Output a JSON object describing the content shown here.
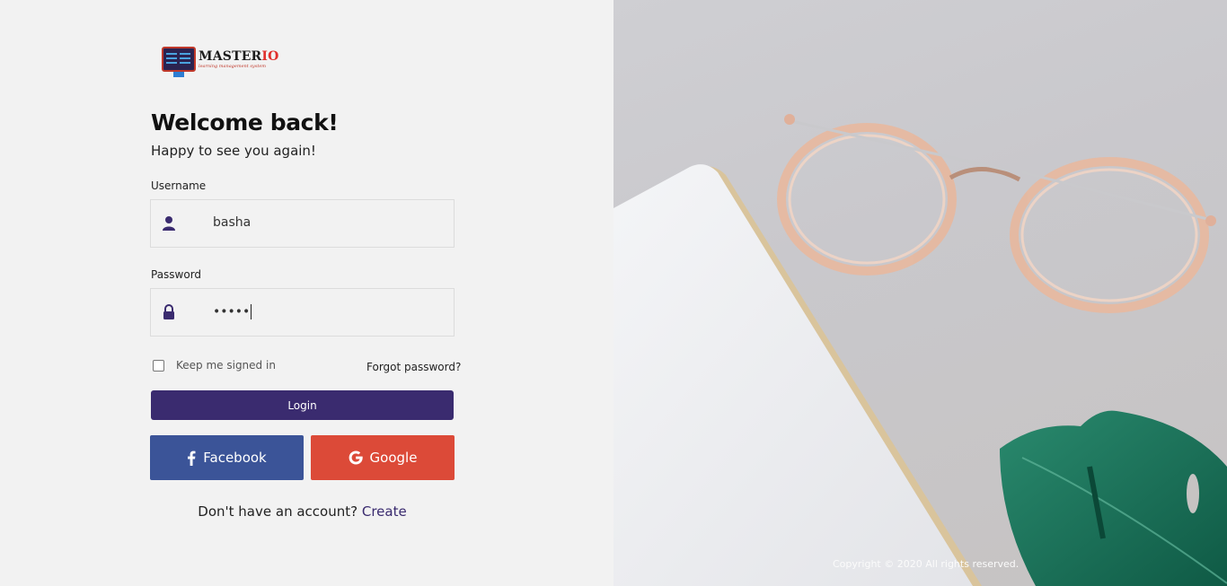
{
  "logo": {
    "name_main": "MASTER",
    "name_accent": "IO",
    "tagline": "learning management system"
  },
  "heading": {
    "title": "Welcome back!",
    "subtitle": "Happy to see you again!"
  },
  "username": {
    "label": "Username",
    "value": "basha",
    "icon": "user-icon"
  },
  "password": {
    "label": "Password",
    "value": "•••••",
    "icon": "lock-icon"
  },
  "remember": {
    "label": "Keep me signed in",
    "checked": false
  },
  "forgot": {
    "label": "Forgot password?"
  },
  "login": {
    "label": "Login"
  },
  "social": {
    "facebook": {
      "label": "Facebook",
      "icon": "facebook-icon",
      "color": "#3b5498"
    },
    "google": {
      "label": "Google",
      "icon": "google-icon",
      "color": "#dc4a38"
    }
  },
  "signup": {
    "prompt": "Don't have an account?",
    "link": "Create"
  },
  "footer": {
    "copyright": "Copyright © 2020 All rights reserved."
  },
  "colors": {
    "primary": "#3a2b6f",
    "background": "#f2f2f2"
  }
}
